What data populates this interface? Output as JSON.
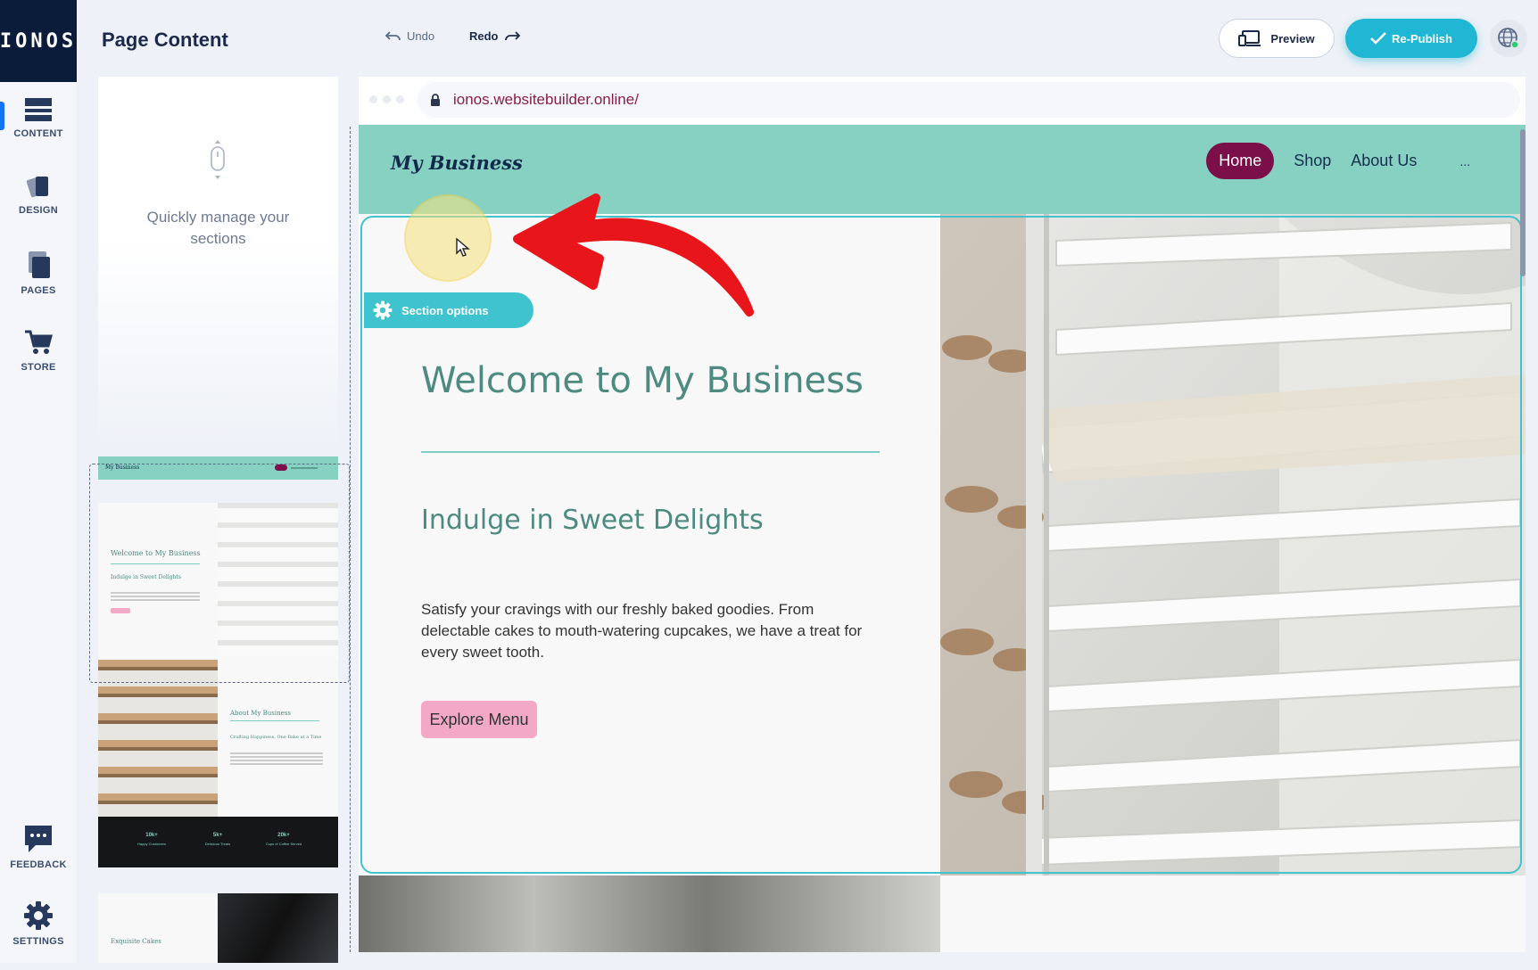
{
  "brand": {
    "logo": "IONOS"
  },
  "rail": {
    "items": [
      {
        "label": "CONTENT",
        "icon": "content-icon"
      },
      {
        "label": "DESIGN",
        "icon": "design-icon"
      },
      {
        "label": "PAGES",
        "icon": "pages-icon"
      },
      {
        "label": "STORE",
        "icon": "cart-icon"
      },
      {
        "label": "FEEDBACK",
        "icon": "chat-icon"
      },
      {
        "label": "SETTINGS",
        "icon": "gear-icon"
      }
    ],
    "active": "CONTENT"
  },
  "toolbar": {
    "title": "Page Content",
    "undo_label": "Undo",
    "redo_label": "Redo",
    "preview_label": "Preview",
    "publish_label": "Re-Publish"
  },
  "panel": {
    "hint_line1": "Quickly manage your",
    "hint_line2": "sections",
    "thumbs": {
      "header_brand": "My Business",
      "hero_title": "Welcome to My Business",
      "hero_sub": "Indulge in Sweet Delights",
      "about_title": "About My Business",
      "about_sub": "Crafting Happiness, One Bake at a Time",
      "stats": [
        {
          "value": "10k+",
          "label": "Happy Customers"
        },
        {
          "value": "5k+",
          "label": "Delicious Treats"
        },
        {
          "value": "20k+",
          "label": "Cups of Coffee Served"
        }
      ],
      "cakes_title": "Exquisite Cakes"
    }
  },
  "browser": {
    "url": "ionos.websitebuilder.online/"
  },
  "site": {
    "brand": "My Business",
    "nav": [
      "Home",
      "Shop",
      "About Us",
      "..."
    ],
    "active_nav": "Home",
    "section_options": "Section options",
    "hero": {
      "title": "Welcome to My Business",
      "subtitle": "Indulge in Sweet Delights",
      "body": "Satisfy your cravings with our freshly baked goodies. From delectable cakes to mouth-watering cupcakes, we have a treat for every sweet tooth.",
      "button": "Explore Menu"
    }
  },
  "colors": {
    "accent": "#3fc4cf",
    "header_bg": "#86d1c2",
    "home_pill": "#7a0f4a",
    "cta": "#f3a9c5",
    "annotation_arrow": "#e8161b",
    "cursor_highlight": "#f6e27a"
  }
}
